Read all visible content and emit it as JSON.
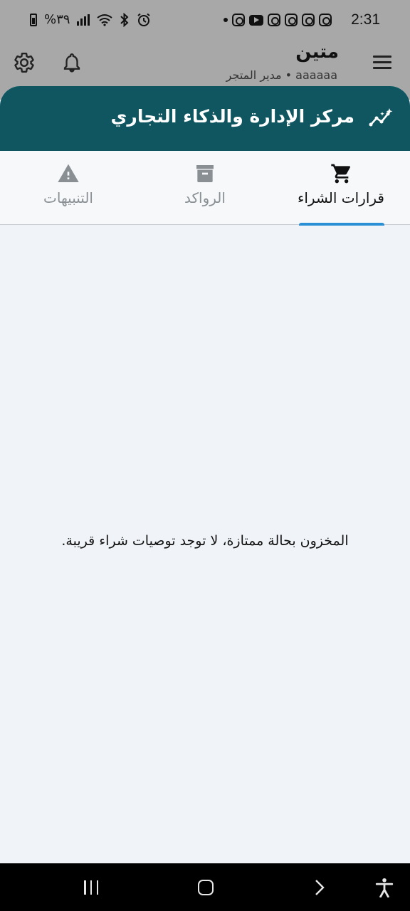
{
  "status_bar": {
    "time": "2:31",
    "battery_text": "%٣٩",
    "notification_icons": [
      "instagram-icon",
      "instagram-icon",
      "instagram-icon",
      "instagram-icon",
      "youtube-icon",
      "instagram-icon"
    ]
  },
  "app_header": {
    "title": "متين",
    "subtitle": "aaaaaa • مدير المتجر"
  },
  "sheet": {
    "title": "مركز الإدارة والذكاء التجاري",
    "tabs": [
      {
        "label": "قرارات الشراء",
        "icon": "shopping-cart-icon",
        "active": true
      },
      {
        "label": "الرواكد",
        "icon": "archive-icon",
        "active": false
      },
      {
        "label": "التنبيهات",
        "icon": "warning-icon",
        "active": false
      }
    ],
    "empty_message": "المخزون بحالة ممتازة، لا توجد توصيات شراء قريبة."
  },
  "colors": {
    "header_teal": "#0f5660",
    "accent_blue": "#2b8fd6",
    "background": "#f0f4f8",
    "inactive_tab": "#8a8f94"
  }
}
